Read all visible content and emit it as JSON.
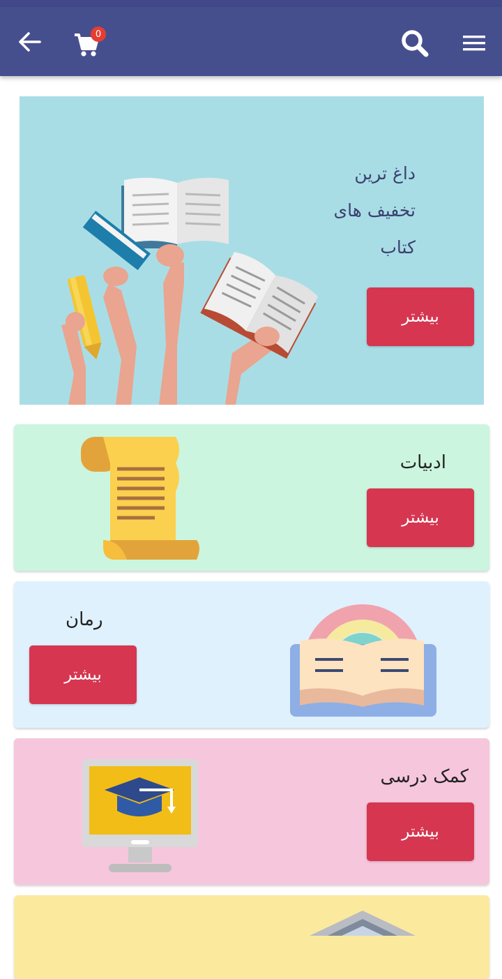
{
  "app": {
    "cart_count": "0",
    "colors": {
      "appbar": "#464f8e",
      "accent_button": "#d63650",
      "badge": "#e63d33"
    }
  },
  "icons": [
    "back-arrow-icon",
    "cart-icon",
    "search-icon",
    "menu-icon"
  ],
  "hero": {
    "line1": "داغ ترین",
    "line2": "تخفیف های",
    "line3": "کتاب",
    "button_label": "بیشتر"
  },
  "categories": [
    {
      "title": "ادبیات",
      "button_label": "بیشتر",
      "icon": "scroll-icon",
      "bg": "#ccf5df"
    },
    {
      "title": "رمان",
      "button_label": "بیشتر",
      "icon": "rainbow-book-icon",
      "bg": "#dff1fd"
    },
    {
      "title": "کمک درسی",
      "button_label": "بیشتر",
      "icon": "graduation-monitor-icon",
      "bg": "#f6c6dc"
    },
    {
      "title": "",
      "button_label": "",
      "icon": "house-icon",
      "bg": "#fbea9e"
    }
  ]
}
